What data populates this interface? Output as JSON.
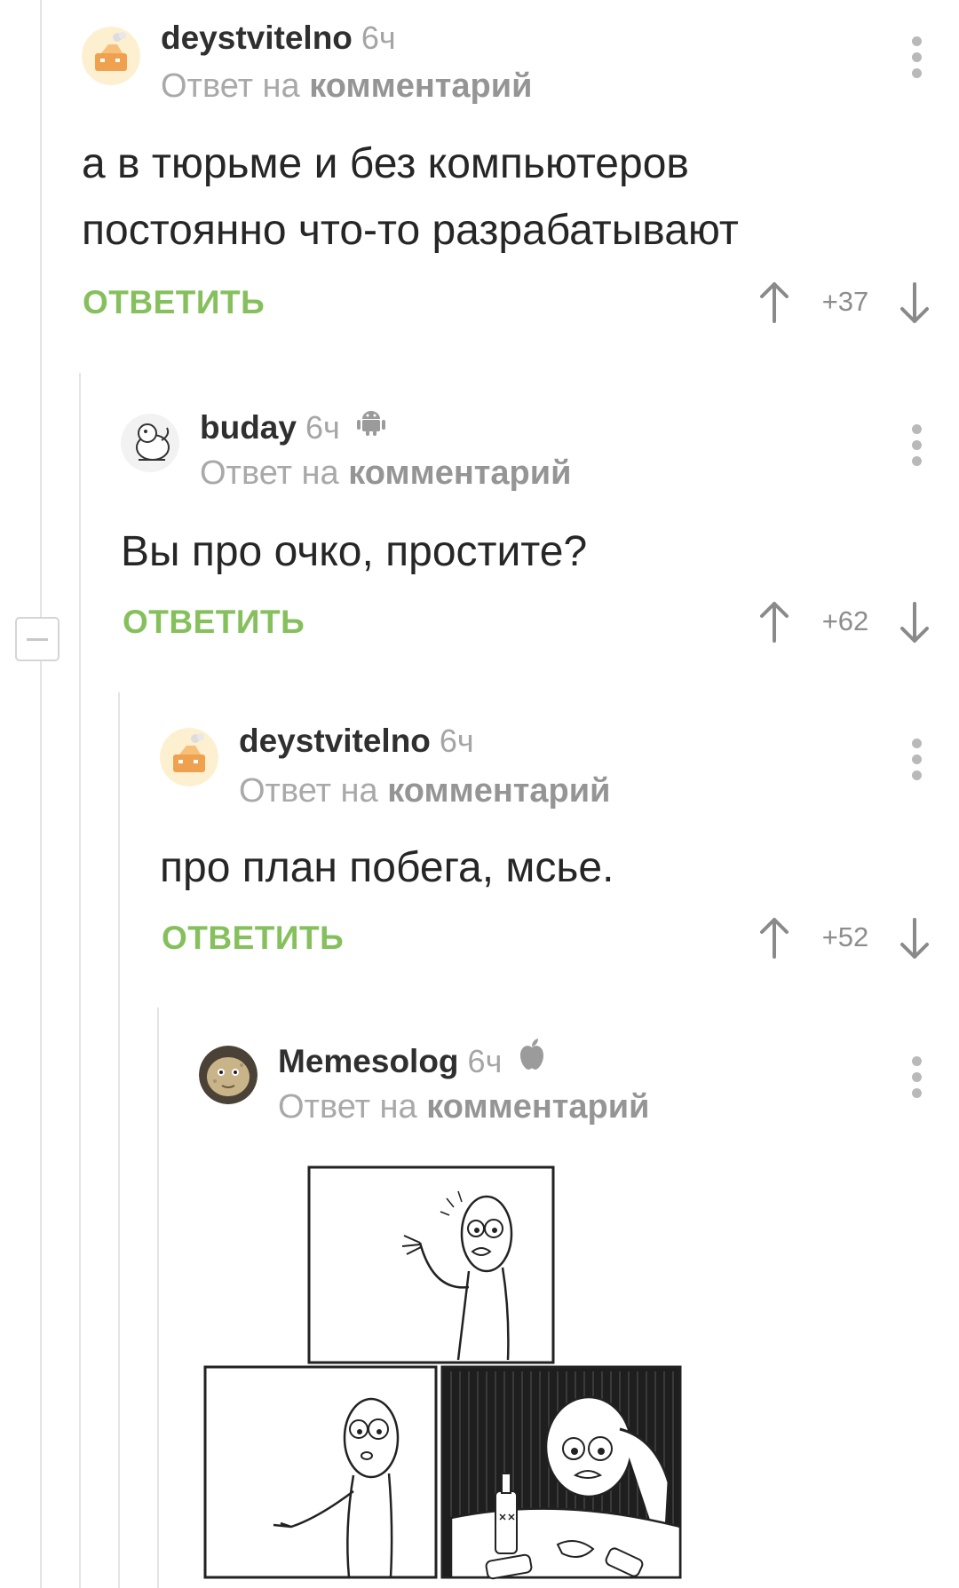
{
  "comments": [
    {
      "author": "deystvitelno",
      "time": "6ч",
      "reply_prefix": "Ответ на",
      "reply_target": "комментарий",
      "text_lines": [
        "а в тюрьме и без компьютеров",
        "постоянно что-то разрабатывают"
      ],
      "reply_label": "ОТВЕТИТЬ",
      "score": "+37"
    },
    {
      "author": "buday",
      "time": "6ч",
      "platform_icon": "android-icon",
      "reply_prefix": "Ответ на",
      "reply_target": "комментарий",
      "text_lines": [
        "Вы про очко, простите?"
      ],
      "reply_label": "ОТВЕТИТЬ",
      "score": "+62"
    },
    {
      "author": "deystvitelno",
      "time": "6ч",
      "reply_prefix": "Ответ на",
      "reply_target": "комментарий",
      "text_lines": [
        "про план побега, мсье."
      ],
      "reply_label": "ОТВЕТИТЬ",
      "score": "+52"
    },
    {
      "author": "Memesolog",
      "time": "6ч",
      "platform_icon": "apple-icon",
      "reply_prefix": "Ответ на",
      "reply_target": "комментарий",
      "image": "rage-comic-meme-image"
    }
  ],
  "colors": {
    "accent_green": "#85c05d",
    "muted_text": "#a9a9a9",
    "thread_line": "#e4e4e4"
  },
  "icons": [
    "more-vert-icon",
    "upvote-arrow-icon",
    "downvote-arrow-icon",
    "collapse-thread-icon"
  ]
}
